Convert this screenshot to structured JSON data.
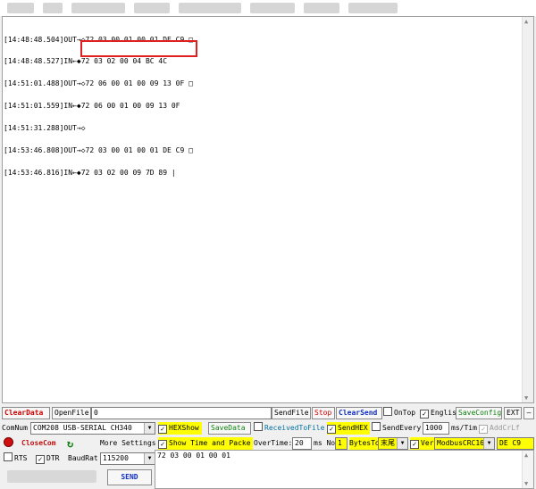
{
  "log": {
    "lines": [
      "[14:48:48.504]OUT→◇72 03 00 01 00 01 DE C9 □",
      "[14:48:48.527]IN←◆72 03 02 00 04 BC 4C",
      "[14:51:01.488]OUT→◇72 06 00 01 00 09 13 0F □",
      "[14:51:01.559]IN←◆72 06 00 01 00 09 13 0F",
      "[14:51:31.288]OUT→◇",
      "[14:53:46.808]OUT→◇72 03 00 01 00 01 DE C9 □",
      "[14:53:46.816]IN←◆72 03 02 00 09 7D 89 |"
    ]
  },
  "toolbar1": {
    "clear_data": "ClearData",
    "open_file": "OpenFile",
    "file_path": "0",
    "send_file": "SendFile",
    "stop": "Stop",
    "clear_send": "ClearSend",
    "on_top": "OnTop",
    "english": "English",
    "save_config": "SaveConfig",
    "ext": "EXT",
    "minus": "—"
  },
  "toolbar2": {
    "com_num_label": "ComNum",
    "com_port": "COM208 USB-SERIAL CH340",
    "hex_show": "HEXShow",
    "save_data": "SaveData",
    "received_to_file": "ReceivedToFile",
    "send_hex": "SendHEX",
    "send_every": "SendEvery:",
    "interval": "1000",
    "interval_unit": "ms/Tim",
    "add_crlf": "AddCrLf"
  },
  "toolbar3": {
    "close_com": "CloseCom",
    "more_settings": "More Settings",
    "show_time": "Show Time and Packe",
    "over_time": "OverTime:",
    "over_time_val": "20",
    "ms_no": "ms No",
    "no_val": "1",
    "bytes_to": "BytesTo",
    "end_val": "末尾",
    "verify": "Verify",
    "verify_mode": "ModbusCRC16",
    "crc_val": "DE C9"
  },
  "toolbar4": {
    "rts": "RTS",
    "dtr": "DTR",
    "baud_label": "BaudRat",
    "baud_val": "115200",
    "send": "SEND"
  },
  "send_box": {
    "value": "72 03 00 01 00 01"
  },
  "colors": {
    "highlight": "#e02020",
    "yellow": "#ffff00",
    "red_text": "#d00000",
    "blue_text": "#1030c0"
  }
}
